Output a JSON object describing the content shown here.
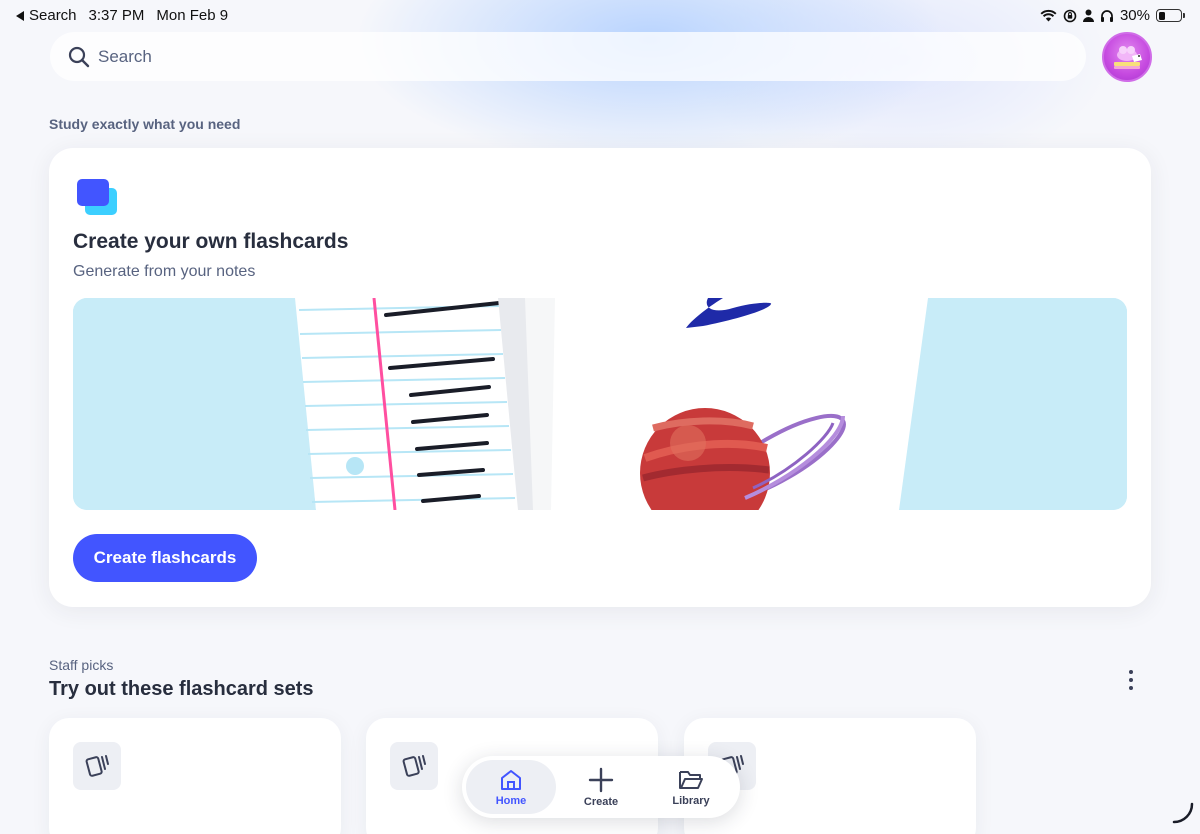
{
  "status_bar": {
    "back_label": "Search",
    "time": "3:37 PM",
    "date": "Mon Feb 9",
    "battery_percent": "30%",
    "battery_level": 0.3
  },
  "search": {
    "placeholder": "Search",
    "icon": "search-icon"
  },
  "avatar": {
    "icon": "profile-avatar"
  },
  "study_section": {
    "label": "Study exactly what you need"
  },
  "feature_card": {
    "icon": "flashcards-icon",
    "title": "Create your own flashcards",
    "subtitle": "Generate from your notes",
    "button_label": "Create flashcards",
    "accent_color": "#4255ff",
    "banner_color": "#c8ecf8"
  },
  "staff_picks": {
    "label": "Staff picks",
    "title": "Try out these flashcard sets",
    "more_icon": "more-vertical-icon",
    "sets": [
      {
        "icon": "cards-icon"
      },
      {
        "icon": "cards-icon"
      },
      {
        "icon": "cards-icon"
      }
    ]
  },
  "tabbar": {
    "tabs": [
      {
        "label": "Home",
        "icon": "home-icon",
        "active": true
      },
      {
        "label": "Create",
        "icon": "plus-icon",
        "active": false
      },
      {
        "label": "Library",
        "icon": "folder-icon",
        "active": false
      }
    ]
  }
}
